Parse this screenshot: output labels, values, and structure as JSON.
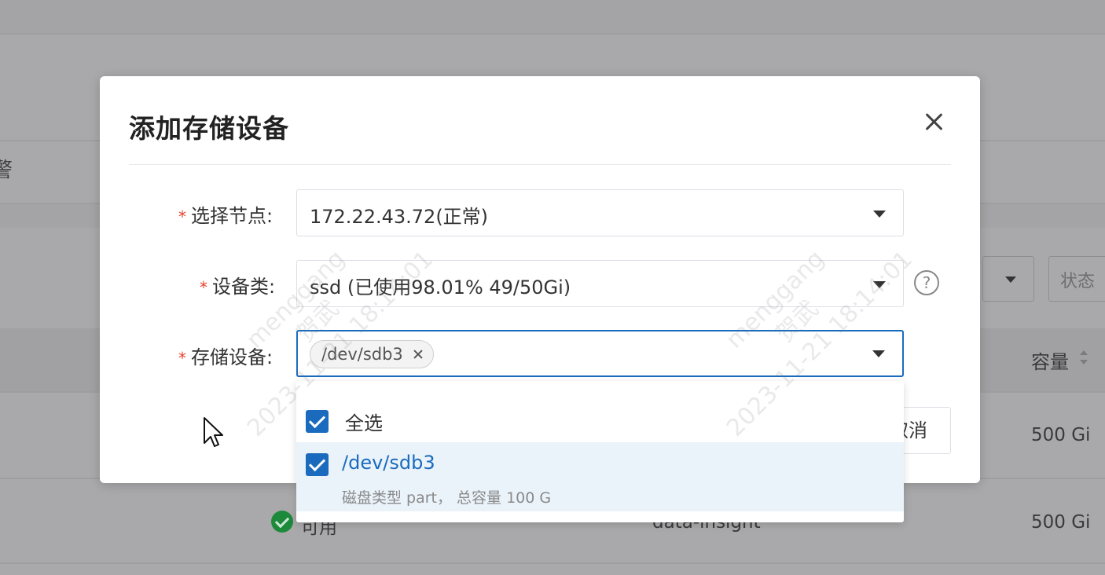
{
  "background": {
    "left_heading": "警",
    "status_filter_placeholder": "状态",
    "column_capacity": "容量",
    "rows": [
      {
        "capacity": "500 Gi"
      },
      {
        "status": "可用",
        "name": "data-insight",
        "capacity": "500 Gi"
      }
    ]
  },
  "modal": {
    "title": "添加存储设备",
    "fields": {
      "node": {
        "label": "选择节点:",
        "value": "172.22.43.72(正常)"
      },
      "device_class": {
        "label": "设备类:",
        "value": "ssd (已使用98.01%  49/50Gi)"
      },
      "storage_device": {
        "label": "存储设备:",
        "tags": [
          "/dev/sdb3"
        ]
      }
    },
    "help_icon": "?",
    "cancel_button": "取消"
  },
  "dropdown": {
    "select_all": "全选",
    "options": [
      {
        "label": "/dev/sdb3",
        "detail": "磁盘类型 part， 总容量 100 G",
        "checked": true
      }
    ]
  },
  "watermark": {
    "user": "menggang",
    "name": "贺武",
    "time": "2023-11-21 18:14:01"
  },
  "colors": {
    "primary": "#1a6bbd",
    "required": "#e8402b",
    "selected_bg": "#eaf2fa",
    "overlay": "#a9a9ab"
  }
}
